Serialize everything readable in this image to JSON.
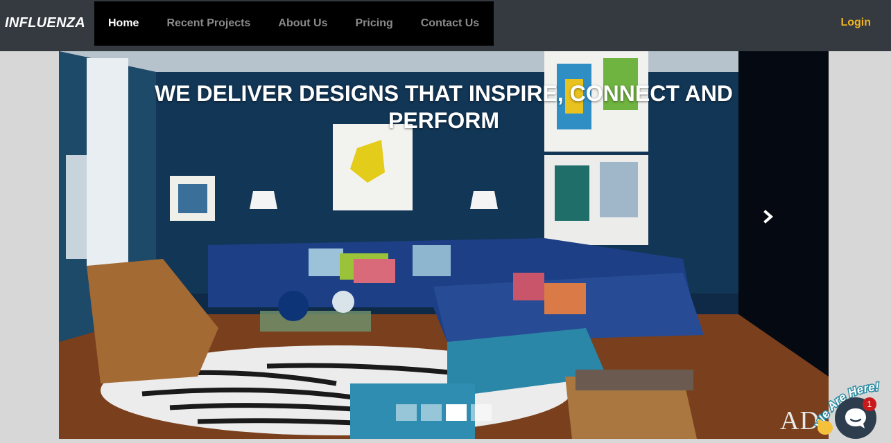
{
  "brand": "INFLUENZA",
  "nav": {
    "items": [
      {
        "label": "Home",
        "active": true
      },
      {
        "label": "Recent Projects",
        "active": false
      },
      {
        "label": "About Us",
        "active": false
      },
      {
        "label": "Pricing",
        "active": false
      },
      {
        "label": "Contact Us",
        "active": false
      }
    ],
    "login": "Login"
  },
  "hero": {
    "headline": "WE DELIVER DESIGNS THAT INSPIRE, CONNECT AND PERFORM",
    "watermark": "AD",
    "slides_total": 4,
    "active_slide": 3,
    "next_icon": "chevron-right-icon"
  },
  "chat": {
    "tagline": "We Are Here!",
    "unread": "1",
    "icon": "chat-bubble-icon",
    "wave_icon": "waving-hand-icon"
  },
  "colors": {
    "navbar": "#343a40",
    "menu_bg": "#000000",
    "login": "#f0b323",
    "page_bg": "#d7d7d7",
    "chat_button": "#2d3d4d",
    "badge": "#c81a1a"
  }
}
